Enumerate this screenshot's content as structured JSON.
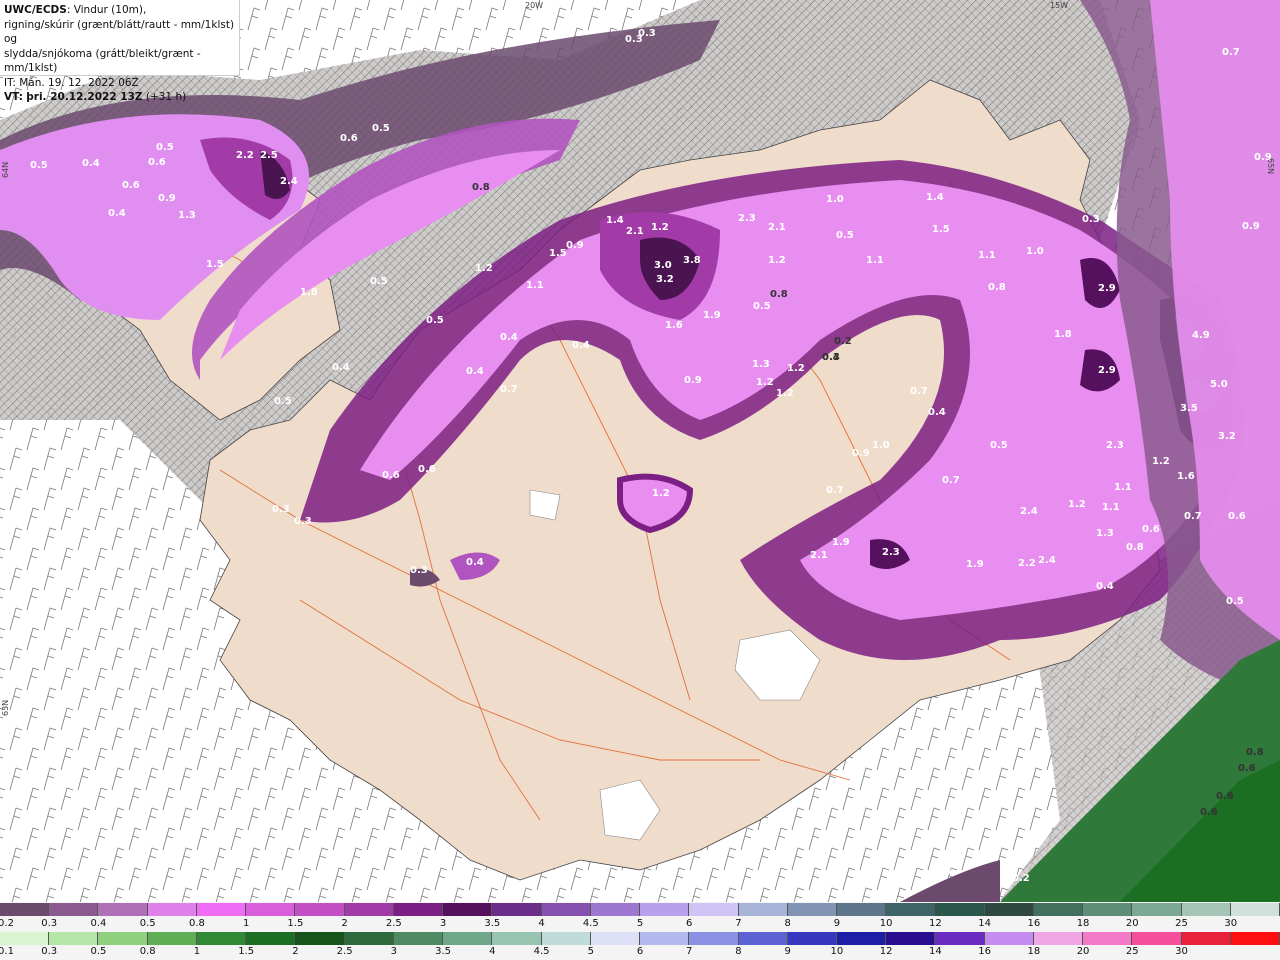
{
  "header": {
    "source": "UWC/ECDS",
    "line1_rest": ": Vindur (10m),",
    "line2": "rigning/skúrir (grænt/blátt/rautt - mm/1klst) og",
    "line3": "slydda/snjókoma (grátt/bleikt/grænt - mm/1klst)",
    "line4": "IT: Mán. 19. 12. 2022 06Z",
    "vt_label": "VT:",
    "vt_value": "þri. 20.12.2022 13Z",
    "vt_offset": "(+31 h)"
  },
  "grid_labels": [
    "20W",
    "15W",
    "65N",
    "64N",
    "63N"
  ],
  "map_values": [
    "0.3",
    "0.3",
    "0.7",
    "0.9",
    "0.9",
    "0.5",
    "0.4",
    "0.6",
    "0.6",
    "0.5",
    "0.6",
    "0.5",
    "0.9",
    "2.2",
    "2.5",
    "2.4",
    "1.3",
    "0.4",
    "1.5",
    "1.8",
    "0.5",
    "0.5",
    "0.4",
    "0.8",
    "0.4",
    "0.5",
    "1.4",
    "2.1",
    "1.2",
    "3.0",
    "3.8",
    "3.2",
    "2.3",
    "2.1",
    "1.2",
    "1.0",
    "1.4",
    "1.5",
    "0.3",
    "1.2",
    "0.9",
    "1.5",
    "1.1",
    "1.0",
    "1.1",
    "1.1",
    "0.8",
    "0.5",
    "0.8",
    "0.5",
    "1.6",
    "1.9",
    "0.4",
    "0.4",
    "0.4",
    "0.3",
    "0.2",
    "2.9",
    "1.8",
    "2.9",
    "4.9",
    "5.0",
    "3.5",
    "3.2",
    "0.7",
    "0.7",
    "0.4",
    "1.3",
    "1.2",
    "1.2",
    "1.2",
    "0.9",
    "1.0",
    "0.9",
    "0.5",
    "2.3",
    "1.2",
    "1.6",
    "1.1",
    "1.2",
    "1.1",
    "0.7",
    "0.7",
    "0.6",
    "1.2",
    "0.6",
    "0.6",
    "0.3",
    "0.3",
    "0.7",
    "2.4",
    "1.9",
    "2.1",
    "2.3",
    "1.9",
    "2.2",
    "2.4",
    "1.3",
    "0.8",
    "0.6",
    "0.4",
    "0.5",
    "0.4",
    "0.3",
    "0.8",
    "0.6",
    "0.6",
    "0.6",
    "0.3",
    "0.2"
  ],
  "scale_top": {
    "labels": [
      "0.2",
      "0.3",
      "0.4",
      "0.5",
      "0.8",
      "1",
      "1.5",
      "2",
      "2.5",
      "3",
      "3.5",
      "4",
      "4.5",
      "5",
      "6",
      "7",
      "8",
      "9",
      "10",
      "12",
      "14",
      "16",
      "18",
      "20",
      "25",
      "30"
    ],
    "colors": [
      "#6b4a6e",
      "#8a5a8e",
      "#b070b8",
      "#e080ea",
      "#f06cf4",
      "#d95edc",
      "#c24fc6",
      "#a23ba8",
      "#7c1f84",
      "#55105e",
      "#6a2e8a",
      "#8550b0",
      "#9e78d0",
      "#b8a0ec",
      "#cfc4f5",
      "#a8b4d8",
      "#8294b4",
      "#5e768c",
      "#3e6468",
      "#2a564c",
      "#2e4a40",
      "#43705e",
      "#5e8e78",
      "#7da896",
      "#a4c4b6",
      "#d0e0da"
    ]
  },
  "scale_bot": {
    "labels": [
      "0.1",
      "0.3",
      "0.5",
      "0.8",
      "1",
      "1.5",
      "2",
      "2.5",
      "3",
      "3.5",
      "4",
      "4.5",
      "5",
      "6",
      "7",
      "8",
      "9",
      "10",
      "12",
      "14",
      "16",
      "18",
      "20",
      "25",
      "30"
    ],
    "colors": [
      "#d8f5d0",
      "#b5e6a8",
      "#8fd07e",
      "#5fae55",
      "#2f8a33",
      "#1b6e22",
      "#16541c",
      "#2e6a3c",
      "#4e8a62",
      "#6fa888",
      "#96c4b0",
      "#c0dcd8",
      "#dde0f7",
      "#b4b9f0",
      "#8a90e4",
      "#5c62d4",
      "#3638c0",
      "#1d1ea8",
      "#2a0e90",
      "#6a2cc0",
      "#c48cf0",
      "#f0a6e4",
      "#f47ac8",
      "#f44e9c",
      "#e8223c",
      "#ff1010"
    ]
  },
  "colors": {
    "land": "#f0dccb",
    "sea_white": "#ffffff",
    "precip_light": "#e88ef0",
    "precip_mid": "#b054c0",
    "precip_dark": "#4a1450",
    "rain_green": "#2f7a3a",
    "road": "#e0703a"
  },
  "icons": [
    "wind-barb-icon",
    "hatch-pattern"
  ]
}
